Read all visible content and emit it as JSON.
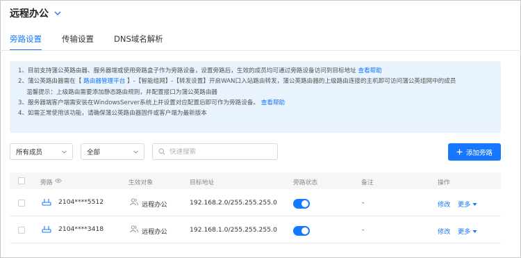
{
  "header": {
    "title": "远程办公"
  },
  "tabs": [
    {
      "label": "旁路设置",
      "active": true
    },
    {
      "label": "传输设置",
      "active": false
    },
    {
      "label": "DNS域名解析",
      "active": false
    }
  ],
  "notice": {
    "l1_text": "1、目前支持蒲公英路由器、服务器端或使用旁路盒子作为旁路设备，设置旁路后，生效的成员均可通过旁路设备访问到目标地址",
    "l1_link": "查看帮助",
    "l2_a": "2、蒲公英路由器需在【",
    "l2_link": "路由器管理平台",
    "l2_b": "】-【智能组网】-【转发设置】开启WAN口入站路由转发，蒲公英路由器的上级路由连接的主机即可访问蒲公英组网中的成员",
    "l3": "温馨提示：上级路由需要添加静态路由规则，并配置接口为蒲公英路由器",
    "l4_text": "3、服务器端客户端需安装在WindowsServer系统上并设置对应配置后即可作为旁路设备。",
    "l4_link": "查看帮助",
    "l5": "4、如需正常使用该功能，请确保蒲公英路由器固件或客户端为最新版本"
  },
  "filters": {
    "member_select": "所有成员",
    "all_select": "全部",
    "search_placeholder": "快速搜索",
    "add_button": "添加旁路"
  },
  "table": {
    "headers": {
      "bypass": "旁路",
      "target_obj": "生效对象",
      "target_addr": "目标地址",
      "status": "旁路状态",
      "remark": "备注",
      "ops": "操作"
    },
    "rows": [
      {
        "device": "2104****5512",
        "object": "远程办公",
        "address": "192.168.2.0/255.255.255.0",
        "enabled": true,
        "remark": "-",
        "edit": "修改",
        "more": "更多"
      },
      {
        "device": "2104****3418",
        "object": "远程办公",
        "address": "192.168.1.0/255.255.255.0",
        "enabled": true,
        "remark": "-",
        "edit": "修改",
        "more": "更多"
      }
    ]
  },
  "colors": {
    "accent": "#1677ff",
    "notice_bg": "#e8f3fd"
  }
}
